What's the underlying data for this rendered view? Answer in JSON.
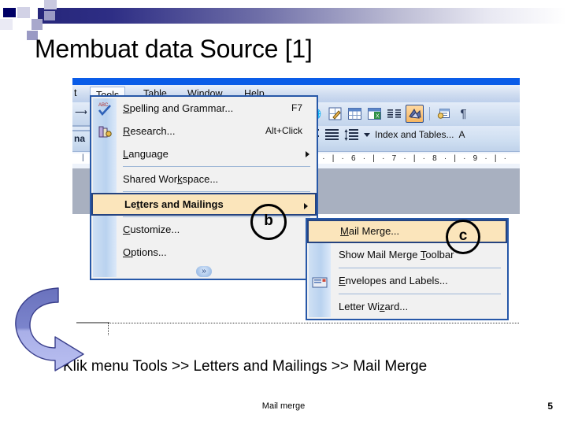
{
  "slide": {
    "title": "Membuat data Source [1]",
    "caption": "Klik menu Tools >> Letters and Mailings >> Mail Merge",
    "footer_text": "Mail merge",
    "page_number": "5"
  },
  "screenshot": {
    "menubar": {
      "left_fragment": "t",
      "items": [
        {
          "label": "Tools",
          "accel": "T",
          "selected": true
        },
        {
          "label": "Table",
          "accel": "a",
          "selected": false
        },
        {
          "label": "Window",
          "accel": "W",
          "selected": false
        },
        {
          "label": "Help",
          "accel": "H",
          "selected": false
        }
      ]
    },
    "toolbar": {
      "icons": [
        {
          "name": "web-tools-icon",
          "glyph": "🌐",
          "active": false
        },
        {
          "name": "drawing-edit-icon",
          "glyph": "✎",
          "active": false
        },
        {
          "name": "insert-table-icon",
          "glyph": "☷",
          "active": false
        },
        {
          "name": "insert-excel-worksheet-icon",
          "glyph": "▦",
          "active": false
        },
        {
          "name": "columns-icon",
          "glyph": "≡",
          "active": false
        },
        {
          "name": "drawing-toolbar-icon",
          "glyph": "◢",
          "active": true
        },
        {
          "name": "document-map-icon",
          "glyph": "⌕",
          "active": false
        },
        {
          "name": "show-formatting-marks-icon",
          "glyph": "¶",
          "active": false
        }
      ],
      "row2": {
        "align_center_icon": "align-center-icon",
        "align_justify_icon": "align-justify-icon",
        "line_spacing_icon": "line-spacing-icon",
        "dropdown_icon": "chevron-down-icon",
        "style_label": "Index and Tables...",
        "trailing_label": "A"
      }
    },
    "ruler": {
      "marks": "· 5 · | · 6 · | · 7 · | · 8 · | · 9 · | ·"
    },
    "tools_menu": {
      "items": [
        {
          "type": "item",
          "label_pre": "",
          "accel": "S",
          "label_post": "pelling and Grammar...",
          "shortcut": "F7",
          "icon": "spelling-check-icon",
          "submenu": false,
          "selected": false
        },
        {
          "type": "item",
          "label_pre": "",
          "accel": "R",
          "label_post": "esearch...",
          "shortcut": "Alt+Click",
          "icon": "research-icon",
          "submenu": false,
          "selected": false
        },
        {
          "type": "item",
          "label_pre": "",
          "accel": "L",
          "label_post": "anguage",
          "shortcut": "",
          "icon": "",
          "submenu": true,
          "selected": false
        },
        {
          "type": "separator"
        },
        {
          "type": "item",
          "label_pre": "Shared Wor",
          "accel": "k",
          "label_post": "space...",
          "shortcut": "",
          "icon": "",
          "submenu": false,
          "selected": false
        },
        {
          "type": "separator"
        },
        {
          "type": "item",
          "label_pre": "Le",
          "accel": "t",
          "label_post": "ters and Mailings",
          "shortcut": "",
          "icon": "",
          "submenu": true,
          "selected": true
        },
        {
          "type": "separator"
        },
        {
          "type": "item",
          "label_pre": "",
          "accel": "C",
          "label_post": "ustomize...",
          "shortcut": "",
          "icon": "",
          "submenu": false,
          "selected": false
        },
        {
          "type": "item",
          "label_pre": "",
          "accel": "O",
          "label_post": "ptions...",
          "shortcut": "",
          "icon": "",
          "submenu": false,
          "selected": false
        }
      ],
      "expand_glyph": "»"
    },
    "letters_submenu": {
      "items": [
        {
          "type": "item",
          "label_pre": "",
          "accel": "M",
          "label_post": "ail Merge...",
          "icon": "",
          "selected": true
        },
        {
          "type": "item",
          "label_pre": "Show Mail Merge ",
          "accel": "T",
          "label_post": "oolbar",
          "icon": "",
          "selected": false
        },
        {
          "type": "separator"
        },
        {
          "type": "item",
          "label_pre": "",
          "accel": "E",
          "label_post": "nvelopes and Labels...",
          "icon": "envelope-label-icon",
          "selected": false
        },
        {
          "type": "separator"
        },
        {
          "type": "item",
          "label_pre": "Letter Wi",
          "accel": "z",
          "label_post": "ard...",
          "icon": "",
          "selected": false
        }
      ]
    },
    "callouts": [
      {
        "name": "callout-b",
        "label": "b"
      },
      {
        "name": "callout-c",
        "label": "c"
      }
    ]
  },
  "colors": {
    "title_bar_blue": "#0a5ce8",
    "menu_border_blue": "#2758a8",
    "highlight_tan": "#fbe5bb",
    "arrow_purple_light": "#9aa0e8",
    "arrow_purple_dark": "#5a62b8",
    "deco_navy": "#000066"
  }
}
